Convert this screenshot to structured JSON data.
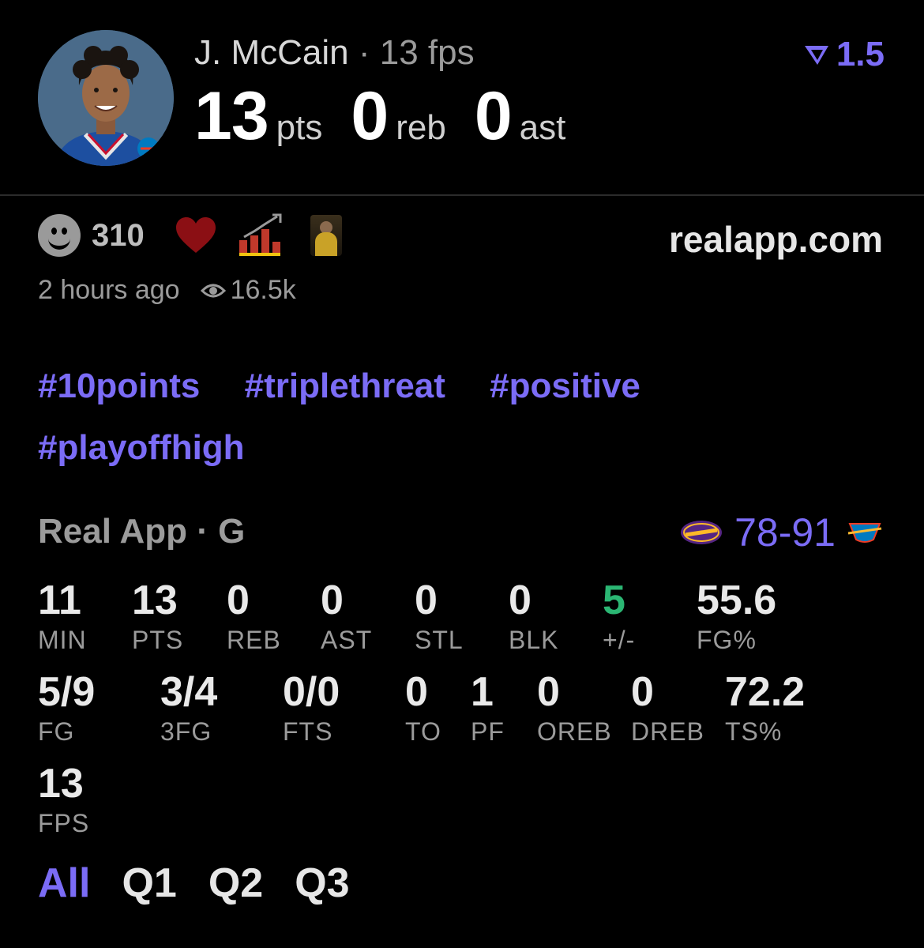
{
  "header": {
    "player_name": "J. McCain",
    "separator": "·",
    "fps_label": "13 fps",
    "points": "13",
    "points_unit": "pts",
    "rebounds": "0",
    "rebounds_unit": "reb",
    "assists": "0",
    "assists_unit": "ast",
    "multiplier": "1.5"
  },
  "reactions": {
    "count": "310",
    "emojis": [
      "smile-icon",
      "heart-icon",
      "chart-icon",
      "player-photo-icon"
    ],
    "site": "realapp.com",
    "time_ago": "2 hours ago",
    "views": "16.5k"
  },
  "hashtags": [
    "#10points",
    "#triplethreat",
    "#positive",
    "#playoffhigh"
  ],
  "game": {
    "source": "Real App · G",
    "away_team": "LAKERS",
    "home_team": "OKC",
    "score": "78-91"
  },
  "stats": {
    "row1": [
      {
        "value": "11",
        "label": "MIN"
      },
      {
        "value": "13",
        "label": "PTS"
      },
      {
        "value": "0",
        "label": "REB"
      },
      {
        "value": "0",
        "label": "AST"
      },
      {
        "value": "0",
        "label": "STL"
      },
      {
        "value": "0",
        "label": "BLK"
      },
      {
        "value": "5",
        "label": "+/-"
      },
      {
        "value": "55.6",
        "label": "FG%"
      }
    ],
    "row2": [
      {
        "value": "5/9",
        "label": "FG"
      },
      {
        "value": "3/4",
        "label": "3FG"
      },
      {
        "value": "0/0",
        "label": "FTS"
      },
      {
        "value": "0",
        "label": "TO"
      },
      {
        "value": "1",
        "label": "PF"
      },
      {
        "value": "0",
        "label": "OREB"
      },
      {
        "value": "0",
        "label": "DREB"
      },
      {
        "value": "72.2",
        "label": "TS%"
      }
    ],
    "row3": [
      {
        "value": "13",
        "label": "FPS"
      }
    ]
  },
  "periods": {
    "items": [
      "All",
      "Q1",
      "Q2",
      "Q3"
    ],
    "active": "All"
  },
  "colors": {
    "accent": "#7b6cf6",
    "positive": "#2bb673",
    "heart": "#8b0f14"
  }
}
